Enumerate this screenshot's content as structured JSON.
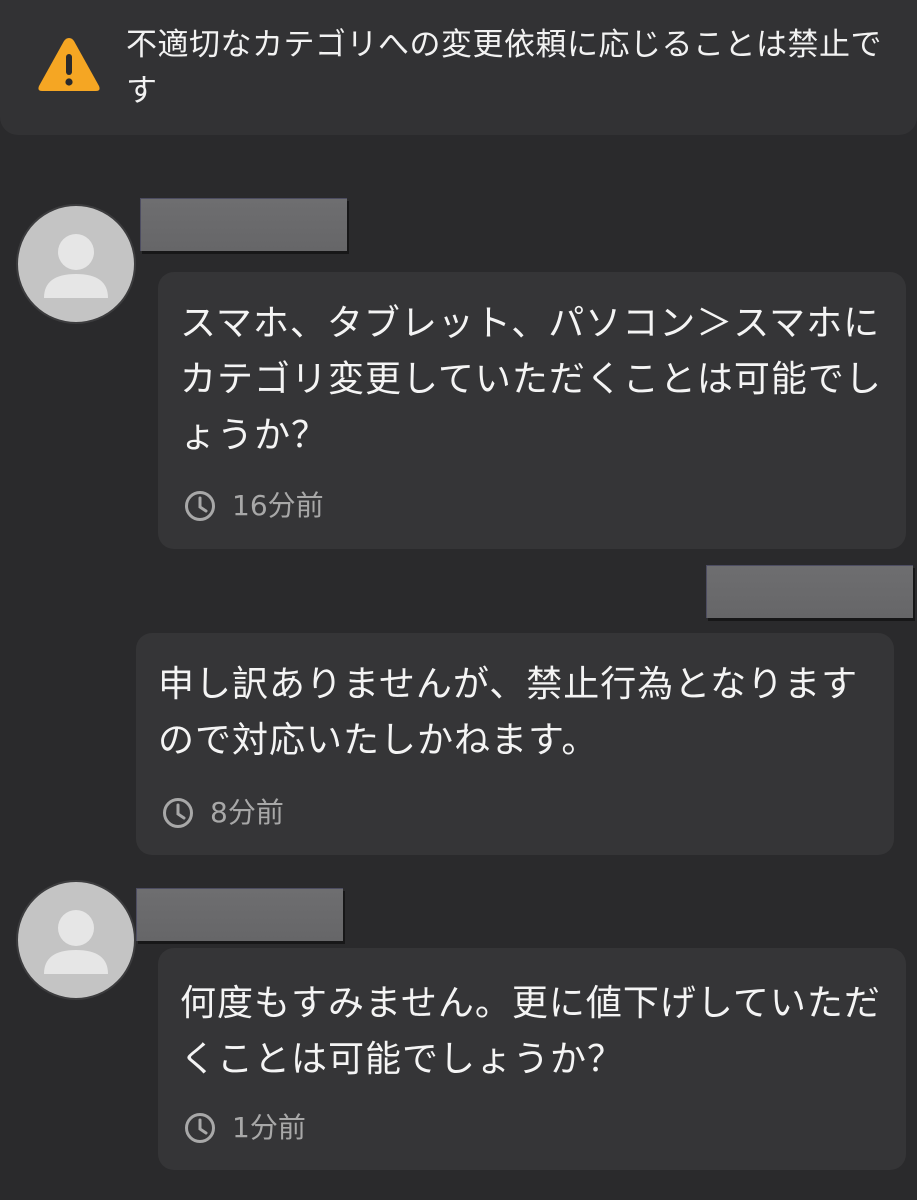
{
  "warning": {
    "icon": "warning-triangle-icon",
    "text": "不適切なカテゴリへの変更依頼に応じることは禁止です"
  },
  "messages": [
    {
      "sender": "buyer",
      "text": "スマホ、タブレット、パソコン＞スマホにカテゴリ変更していただくことは可能でしょうか？",
      "time": "16分前"
    },
    {
      "sender": "seller",
      "text": "申し訳ありませんが、禁止行為となりますので対応いたしかねます。",
      "time": "8分前"
    },
    {
      "sender": "buyer",
      "text": "何度もすみません。更に値下げしていただくことは可能でしょうか？",
      "time": "1分前"
    }
  ],
  "colors": {
    "background": "#2a2a2c",
    "bubble": "#353537",
    "warning_accent": "#f5a623",
    "redaction": "#6e6e70"
  }
}
